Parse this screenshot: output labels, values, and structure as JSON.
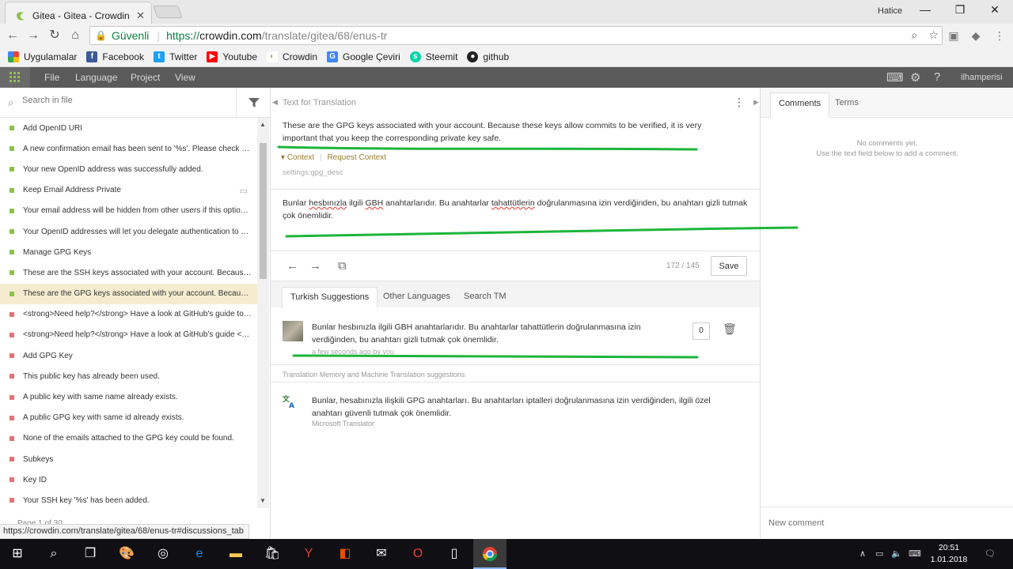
{
  "browser": {
    "tab_title": "Gitea - Gitea - Crowdin t",
    "user": "Hatice",
    "secure_label": "Güvenli",
    "url_scheme": "https://",
    "url_host": "crowdin.com",
    "url_path": "/translate/gitea/68/enus-tr",
    "bookmarks": [
      "Uygulamalar",
      "Facebook",
      "Twitter",
      "Youtube",
      "Crowdin",
      "Google Çeviri",
      "Steemit",
      "github"
    ],
    "status_url": "https://crowdin.com/translate/gitea/68/enus-tr#discussions_tab"
  },
  "menu": {
    "items": [
      "File",
      "Language",
      "Project",
      "View"
    ],
    "user": "ilhamperisi"
  },
  "sidebar": {
    "search_placeholder": "Search in file",
    "strings": [
      {
        "text": "Add OpenID URI",
        "status": "translated"
      },
      {
        "text": "A new confirmation email has been sent to '%s'. Please check your inbox",
        "status": "translated"
      },
      {
        "text": "Your new OpenID address was successfully added.",
        "status": "translated"
      },
      {
        "text": "Keep Email Address Private",
        "status": "translated"
      },
      {
        "text": "Your email address will be hidden from other users if this option is set",
        "status": "translated"
      },
      {
        "text": "Your OpenID addresses will let you delegate authentication to your provider",
        "status": "translated"
      },
      {
        "text": "Manage GPG Keys",
        "status": "translated"
      },
      {
        "text": "These are the SSH keys associated with your account. Because these keys",
        "status": "translated"
      },
      {
        "text": "These are the GPG keys associated with your account. Because these keys",
        "status": "active"
      },
      {
        "text": "<strong>Need help?</strong> Have a look at GitHub's guide to creating",
        "status": "untranslated"
      },
      {
        "text": "<strong>Need help?</strong> Have a look at GitHub's guide <a href",
        "status": "untranslated"
      },
      {
        "text": "Add GPG Key",
        "status": "untranslated"
      },
      {
        "text": "This public key has already been used.",
        "status": "untranslated"
      },
      {
        "text": "A public key with same name already exists.",
        "status": "untranslated"
      },
      {
        "text": "A public GPG key with same id already exists.",
        "status": "untranslated"
      },
      {
        "text": "None of the emails attached to the GPG key could be found.",
        "status": "untranslated"
      },
      {
        "text": "Subkeys",
        "status": "untranslated"
      },
      {
        "text": "Key ID",
        "status": "untranslated"
      },
      {
        "text": "Your SSH key '%s' has been added.",
        "status": "untranslated"
      }
    ],
    "pager": "Page 1 of 30"
  },
  "editor": {
    "source_heading": "Text for Translation",
    "source_text": "These are the GPG keys associated with your account. Because these keys allow commits to be verified, it is very important that you keep the corresponding private key safe.",
    "context_label": "Context",
    "request_context_label": "Request Context",
    "key": "settings:gpg_desc",
    "translation_parts": [
      "Bunlar ",
      "hesbınızla",
      " ilgili ",
      "GBH",
      " anahtarlarıdır. Bu anahtarlar ",
      "tahattütlerin",
      " doğrulanmasına izin verdiğinden, bu anahtarı gizli tutmak çok önemlidir."
    ],
    "counter": "172 / 145",
    "save_label": "Save"
  },
  "suggestions": {
    "tabs": [
      "Turkish Suggestions",
      "Other Languages",
      "Search TM"
    ],
    "user_suggestion": {
      "text": "Bunlar hesbınızla ilgili GBH anahtarlarıdır. Bu anahtarlar tahattütlerin doğrulanmasına izin verdiğinden, bu anahtarı gizli tutmak çok önemlidir.",
      "meta": "a few seconds ago by you",
      "votes": "0"
    },
    "tm_heading": "Translation Memory and Machine Translation suggestions",
    "machine": {
      "text": "Bunlar, hesabınızla ilişkili GPG anahtarları. Bu anahtarları iptalleri doğrulanmasına izin verdiğinden, ilgili özel anahtarı güvenli tutmak çok önemlidir.",
      "source": "Microsoft Translator"
    }
  },
  "comments": {
    "tabs": [
      "Comments",
      "Terms"
    ],
    "empty_line1": "No comments yet.",
    "empty_line2": "Use the text field below to add a comment.",
    "placeholder": "New comment"
  },
  "taskbar": {
    "time": "20:51",
    "date": "1.01.2018"
  },
  "colors": {
    "translated": "#8bc34a",
    "untranslated": "#e57373",
    "annotation": "#1db53a"
  }
}
